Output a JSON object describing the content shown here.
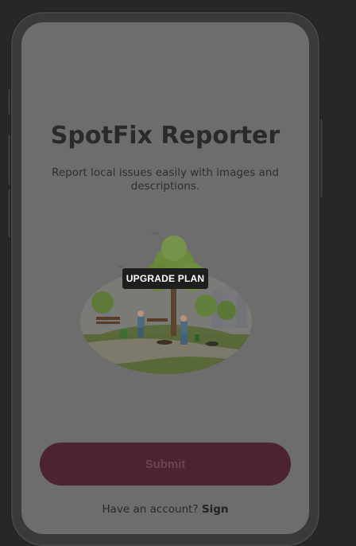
{
  "app": {
    "title": "SpotFix Reporter",
    "subtitle": "Report local issues easily with images and descriptions."
  },
  "illustration": {
    "icon": "park-cleanup-illustration"
  },
  "badge": {
    "label": "UPGRADE PLAN"
  },
  "actions": {
    "submit_label": "Submit",
    "account_prompt": "Have an account?",
    "sign_label": "Sign"
  },
  "colors": {
    "page_background": "#272727",
    "screen_overlay": "#6d6d6d",
    "submit_button": "#4c2331",
    "badge_background": "#1e1e1e"
  }
}
